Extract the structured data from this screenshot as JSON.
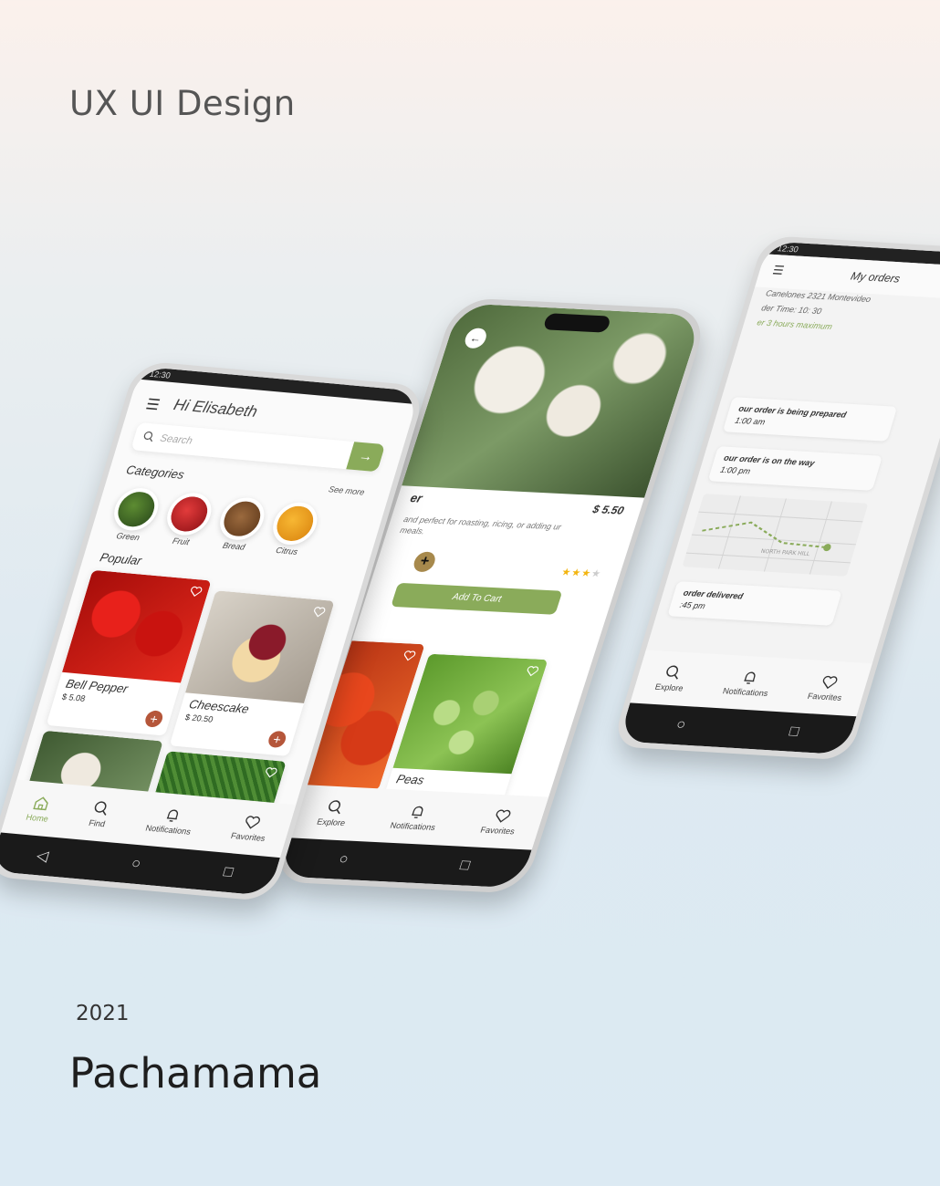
{
  "header": {
    "title": "UX UI Design",
    "year": "2021",
    "brand": "Pachamama"
  },
  "home": {
    "status_time": "12:30",
    "greeting": "Hi Elisabeth",
    "search_placeholder": "Search",
    "categories_title": "Categories",
    "see_more": "See more",
    "categories": [
      {
        "label": "Green"
      },
      {
        "label": "Fruit"
      },
      {
        "label": "Bread"
      },
      {
        "label": "Citrus"
      }
    ],
    "popular_title": "Popular",
    "products": [
      {
        "name": "Bell Pepper",
        "price": "$ 5.08"
      },
      {
        "name": "Cheescake",
        "price": "$ 20.50"
      }
    ],
    "tabs": [
      "Home",
      "Find",
      "Notifications",
      "Favorites"
    ]
  },
  "detail": {
    "name": "er",
    "price": "$ 5.50",
    "description": "and perfect for roasting, ricing, or adding ur meals.",
    "qty_symbol": "+",
    "rating": 3,
    "add_to_cart": "Add To Cart",
    "peas_label": "Peas",
    "tabs": [
      "Explore",
      "Notifications",
      "Favorites"
    ]
  },
  "orders": {
    "status_time": "12:30",
    "title": "My orders",
    "address": "Canelones 2321 Montevideo",
    "order_time": "der Time: 10: 30",
    "hint": "er 3 hours maximum",
    "steps": [
      {
        "title": "our order is being prepared",
        "time": "1:00 am"
      },
      {
        "title": "our order is on the way",
        "time": "1:00 pm"
      },
      {
        "title": "order delivered",
        "time": ":45 pm"
      }
    ],
    "map_label": "NORTH PARK HILL",
    "tabs": [
      "Explore",
      "Notifications",
      "Favorites"
    ]
  },
  "colors": {
    "accent": "#8aab5a",
    "plus": "#b5563a",
    "qty": "#a7894c",
    "star": "#f3b511"
  }
}
